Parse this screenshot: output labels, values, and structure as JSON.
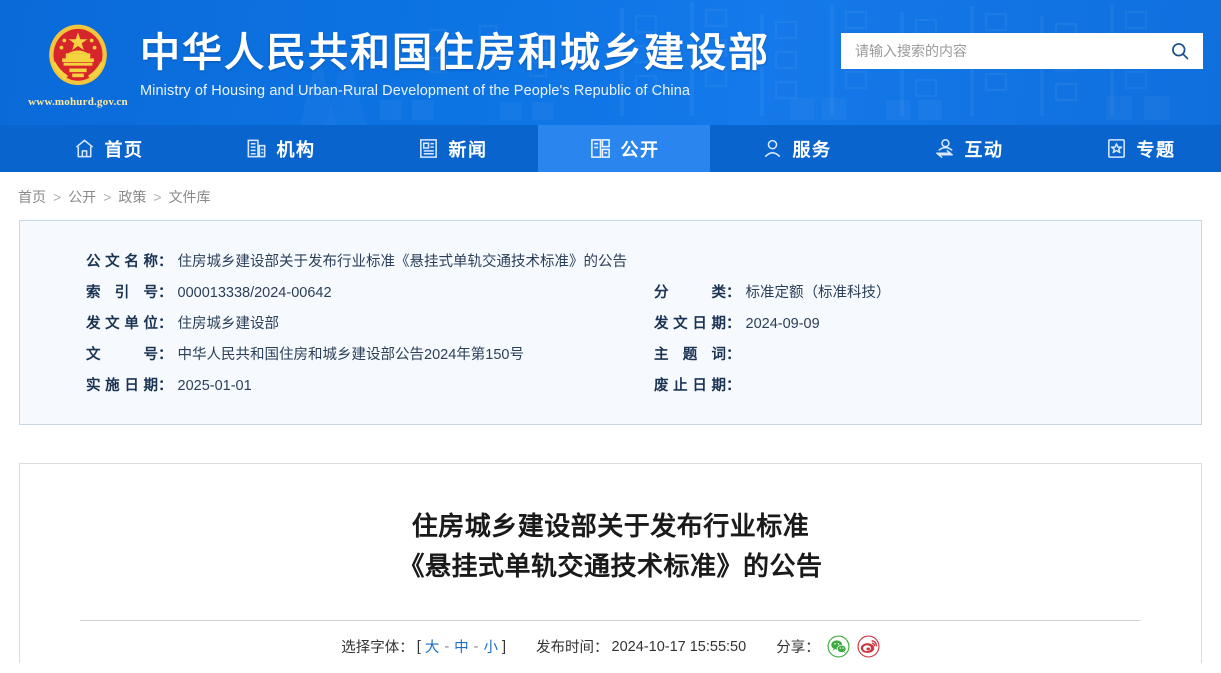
{
  "header": {
    "emblem_icon": "china-national-emblem-icon",
    "site_url": "www.mohurd.gov.cn",
    "title_cn": "中华人民共和国住房和城乡建设部",
    "title_en": "Ministry of Housing and Urban-Rural Development of the People's Republic of China",
    "search": {
      "placeholder": "请输入搜索的内容",
      "value": "",
      "button_icon": "search-icon"
    },
    "colors": {
      "header_bg": "#0d74e4",
      "nav_bg": "#0a64cd",
      "nav_active_bg": "#2b85ef",
      "url_text": "#ffe9a8"
    }
  },
  "nav": {
    "items": [
      {
        "label": "首页",
        "icon": "home-icon",
        "active": false
      },
      {
        "label": "机构",
        "icon": "building-icon",
        "active": false
      },
      {
        "label": "新闻",
        "icon": "news-document-icon",
        "active": false
      },
      {
        "label": "公开",
        "icon": "open-disclosure-icon",
        "active": true
      },
      {
        "label": "服务",
        "icon": "service-person-icon",
        "active": false
      },
      {
        "label": "互动",
        "icon": "interaction-exchange-icon",
        "active": false
      },
      {
        "label": "专题",
        "icon": "star-topic-icon",
        "active": false
      }
    ]
  },
  "breadcrumb": {
    "items": [
      "首页",
      "公开",
      "政策",
      "文件库"
    ],
    "separator": ">"
  },
  "info_card": {
    "left_rows": [
      {
        "label": "公文名称",
        "value": "住房城乡建设部关于发布行业标准《悬挂式单轨交通技术标准》的公告"
      },
      {
        "label": "索引号",
        "value": "000013338/2024-00642"
      },
      {
        "label": "发文单位",
        "value": "住房城乡建设部"
      },
      {
        "label": "文号",
        "value": "中华人民共和国住房和城乡建设部公告2024年第150号"
      },
      {
        "label": "实施日期",
        "value": "2025-01-01"
      }
    ],
    "right_rows": [
      {
        "label": "分类",
        "value": "标准定额（标准科技）"
      },
      {
        "label": "发文日期",
        "value": "2024-09-09"
      },
      {
        "label": "主题词",
        "value": ""
      },
      {
        "label": "废止日期",
        "value": ""
      }
    ],
    "colon": "："
  },
  "article": {
    "title_line1": "住房城乡建设部关于发布行业标准",
    "title_line2": "《悬挂式单轨交通技术标准》的公告",
    "toolbar": {
      "font_label": "选择字体：",
      "bracket_open": "[",
      "bracket_close": "]",
      "font_large": "大",
      "font_medium": "中",
      "font_small": "小",
      "dash": "-",
      "publish_label": "发布时间：",
      "publish_time": "2024-10-17 15:55:50",
      "share_label": "分享：",
      "share_items": [
        {
          "icon": "wechat-share-icon",
          "color": "#3cab3c"
        },
        {
          "icon": "weibo-share-icon",
          "color": "#d0353f"
        }
      ]
    }
  }
}
